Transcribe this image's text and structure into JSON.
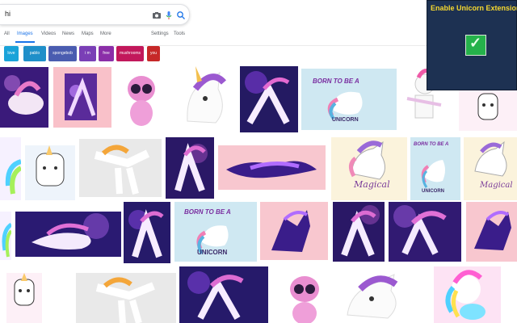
{
  "search": {
    "query": "hi"
  },
  "tabs": [
    {
      "label": "All"
    },
    {
      "label": "Images"
    },
    {
      "label": "Videos"
    },
    {
      "label": "News"
    },
    {
      "label": "Maps"
    },
    {
      "label": "More"
    }
  ],
  "tools": {
    "settings": "Settings",
    "tools": "Tools"
  },
  "chips": [
    {
      "label": "love",
      "color": "#1aa3d9"
    },
    {
      "label": "pablo",
      "color": "#1f8fc9"
    },
    {
      "label": "spongebob",
      "color": "#4a5cb0"
    },
    {
      "label": "i m",
      "color": "#7a3fb6"
    },
    {
      "label": "free",
      "color": "#8b2ea8"
    },
    {
      "label": "mushrooms",
      "color": "#c2185b"
    },
    {
      "label": "you",
      "color": "#c62828"
    }
  ],
  "extension": {
    "title": "Enable Unicorn Extension?"
  },
  "captions": {
    "born1": "BORN TO BE A",
    "unicorn1": "UNICORN",
    "born2": "BORN TO BE A",
    "unicorn2": "UNICORN",
    "born3": "BORN TO BE A",
    "unicorn3": "UNICORN",
    "magical1": "Magical",
    "magical2": "Magical"
  }
}
